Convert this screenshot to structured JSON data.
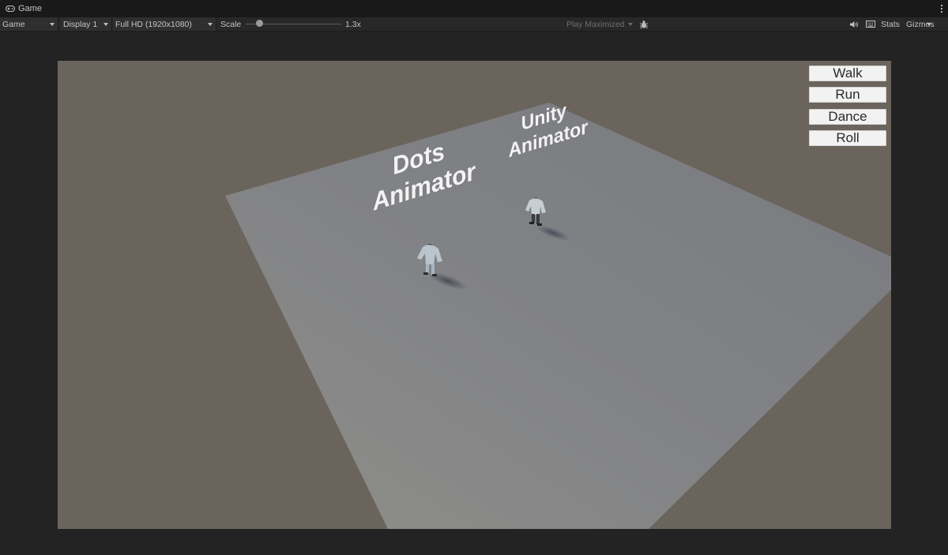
{
  "window": {
    "tab_title": "Game"
  },
  "toolbar": {
    "view_mode": "Game",
    "display": "Display 1",
    "resolution": "Full HD (1920x1080)",
    "scale_label": "Scale",
    "scale_value": "1.3x",
    "play_mode": "Play Maximized",
    "stats": "Stats",
    "gizmos": "Gizmos"
  },
  "game_view": {
    "labels": {
      "dots": "Dots\nAnimator",
      "unity": "Unity\nAnimator"
    },
    "buttons": [
      "Walk",
      "Run",
      "Dance",
      "Roll"
    ]
  },
  "colors": {
    "background": "#6b645d",
    "floor": "#86878a",
    "button": "#f2f2f2"
  }
}
